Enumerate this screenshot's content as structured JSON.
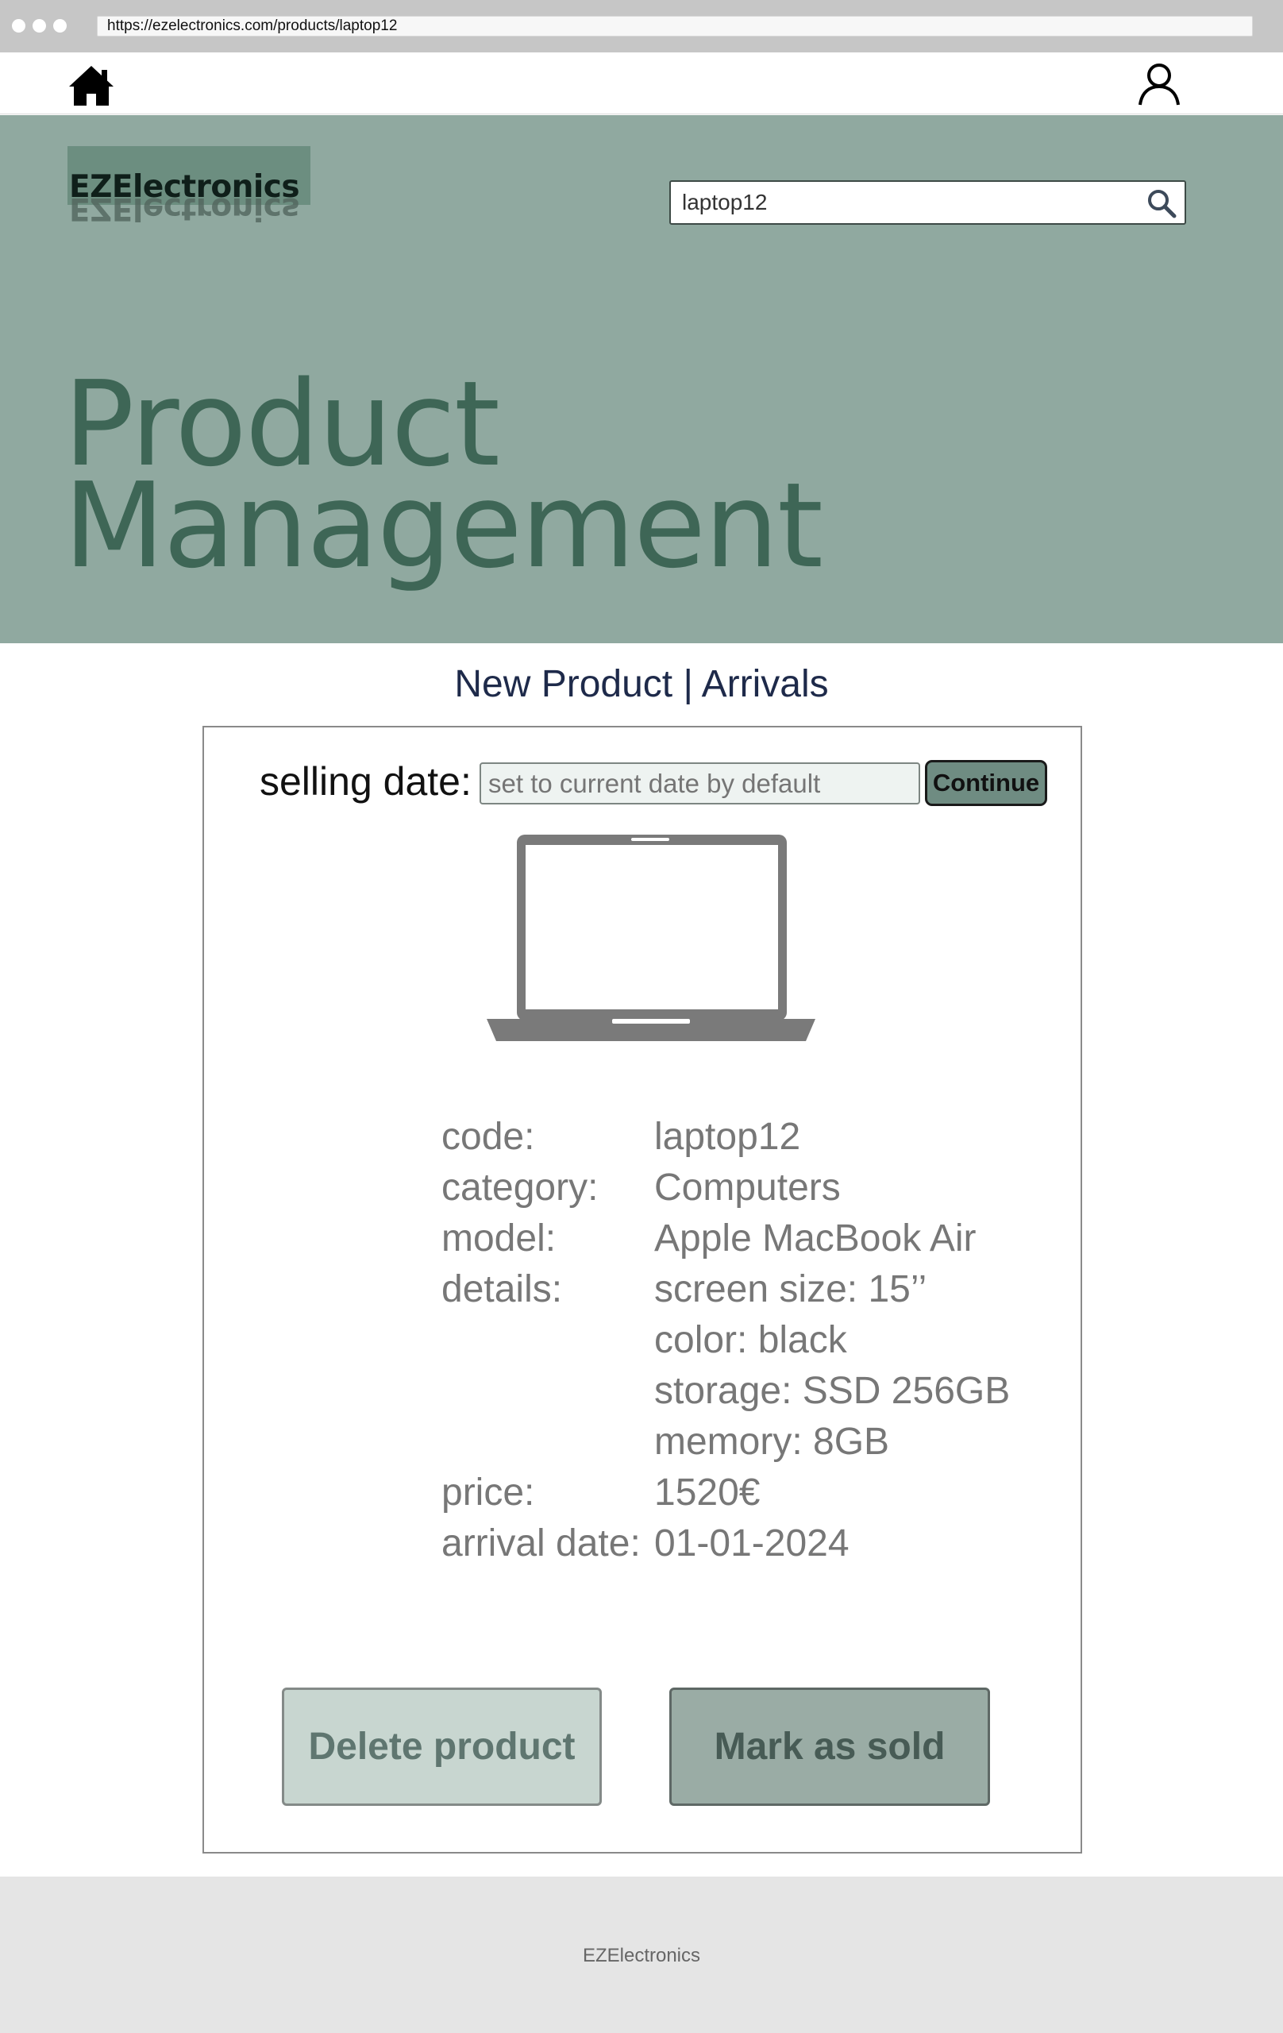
{
  "browser": {
    "url": "https://ezelectronics.com/products/laptop12"
  },
  "header": {
    "logo_text": "EZElectronics",
    "search": {
      "value": "laptop12"
    }
  },
  "hero": {
    "title_line1": "Product",
    "title_line2": "Management"
  },
  "subnav": {
    "new_product": "New Product",
    "separator": "|",
    "arrivals": "Arrivals"
  },
  "sell": {
    "label": "selling date:",
    "placeholder": "set to current date by default",
    "continue_label": "Continue"
  },
  "product": {
    "image_icon": "laptop-icon",
    "fields": [
      {
        "key": "code:",
        "value": "laptop12"
      },
      {
        "key": "category:",
        "value": "Computers"
      },
      {
        "key": "model:",
        "value": "Apple MacBook Air"
      },
      {
        "key": "details:",
        "value": "screen size: 15’’"
      },
      {
        "key": "",
        "value": "color: black"
      },
      {
        "key": "",
        "value": "storage: SSD 256GB"
      },
      {
        "key": "",
        "value": "memory: 8GB"
      },
      {
        "key": "price:",
        "value": "1520€"
      },
      {
        "key": "arrival date:",
        "value": "01-01-2024"
      }
    ]
  },
  "actions": {
    "delete_label": "Delete product",
    "sold_label": "Mark as sold"
  },
  "footer": {
    "text": "EZElectronics"
  },
  "colors": {
    "hero_bg": "#90a9a0",
    "hero_title": "#3e6656",
    "delete_bg": "#c8d6d0",
    "sold_bg": "#9aaca5"
  }
}
